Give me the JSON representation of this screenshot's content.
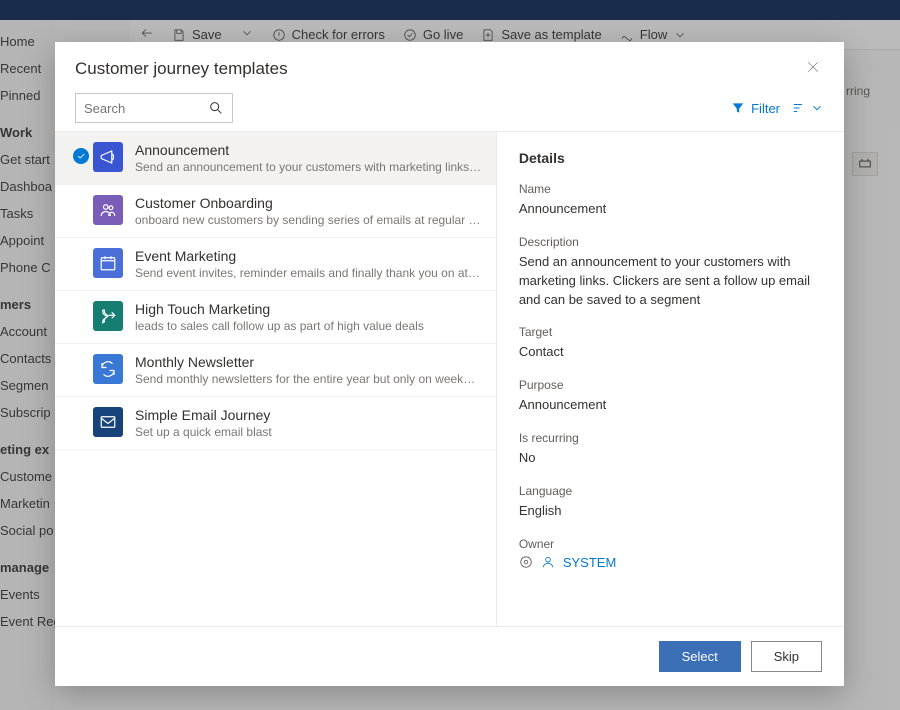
{
  "bg": {
    "cmd": {
      "save": "Save",
      "check": "Check for errors",
      "golive": "Go live",
      "saveas": "Save as template",
      "flow": "Flow"
    },
    "sidebar": [
      {
        "label": "Home",
        "kind": "item"
      },
      {
        "label": "Recent",
        "kind": "item"
      },
      {
        "label": "Pinned",
        "kind": "item"
      },
      {
        "label": "Work",
        "kind": "section"
      },
      {
        "label": "Get start",
        "kind": "item"
      },
      {
        "label": "Dashboa",
        "kind": "item"
      },
      {
        "label": "Tasks",
        "kind": "item"
      },
      {
        "label": "Appoint",
        "kind": "item"
      },
      {
        "label": "Phone C",
        "kind": "item"
      },
      {
        "label": "mers",
        "kind": "section"
      },
      {
        "label": "Account",
        "kind": "item"
      },
      {
        "label": "Contacts",
        "kind": "item"
      },
      {
        "label": "Segmen",
        "kind": "item"
      },
      {
        "label": "Subscrip",
        "kind": "item"
      },
      {
        "label": "eting ex",
        "kind": "section"
      },
      {
        "label": "Custome",
        "kind": "item"
      },
      {
        "label": "Marketin",
        "kind": "item"
      },
      {
        "label": "Social po",
        "kind": "item"
      },
      {
        "label": "manage",
        "kind": "section"
      },
      {
        "label": "Events",
        "kind": "item"
      },
      {
        "label": "Event Registrations",
        "kind": "item"
      }
    ],
    "side_label": "rring"
  },
  "modal": {
    "title": "Customer journey templates",
    "search_placeholder": "Search",
    "filter_label": "Filter",
    "templates": [
      {
        "title": "Announcement",
        "desc": "Send an announcement to your customers with marketing links. Clickers are sent a…",
        "color": "#3955d1"
      },
      {
        "title": "Customer Onboarding",
        "desc": "onboard new customers by sending series of emails at regular cadence",
        "color": "#7a5db8"
      },
      {
        "title": "Event Marketing",
        "desc": "Send event invites, reminder emails and finally thank you on attending",
        "color": "#4b6fd8"
      },
      {
        "title": "High Touch Marketing",
        "desc": "leads to sales call follow up as part of high value deals",
        "color": "#167d73"
      },
      {
        "title": "Monthly Newsletter",
        "desc": "Send monthly newsletters for the entire year but only on weekday afternoons",
        "color": "#3a78d6"
      },
      {
        "title": "Simple Email Journey",
        "desc": "Set up a quick email blast",
        "color": "#16447a"
      }
    ],
    "details": {
      "heading": "Details",
      "name_label": "Name",
      "name_value": "Announcement",
      "desc_label": "Description",
      "desc_value": "Send an announcement to your customers with marketing links. Clickers are sent a follow up email and can be saved to a segment",
      "target_label": "Target",
      "target_value": "Contact",
      "purpose_label": "Purpose",
      "purpose_value": "Announcement",
      "recurring_label": "Is recurring",
      "recurring_value": "No",
      "language_label": "Language",
      "language_value": "English",
      "owner_label": "Owner",
      "owner_value": "SYSTEM"
    },
    "buttons": {
      "select": "Select",
      "skip": "Skip"
    }
  }
}
